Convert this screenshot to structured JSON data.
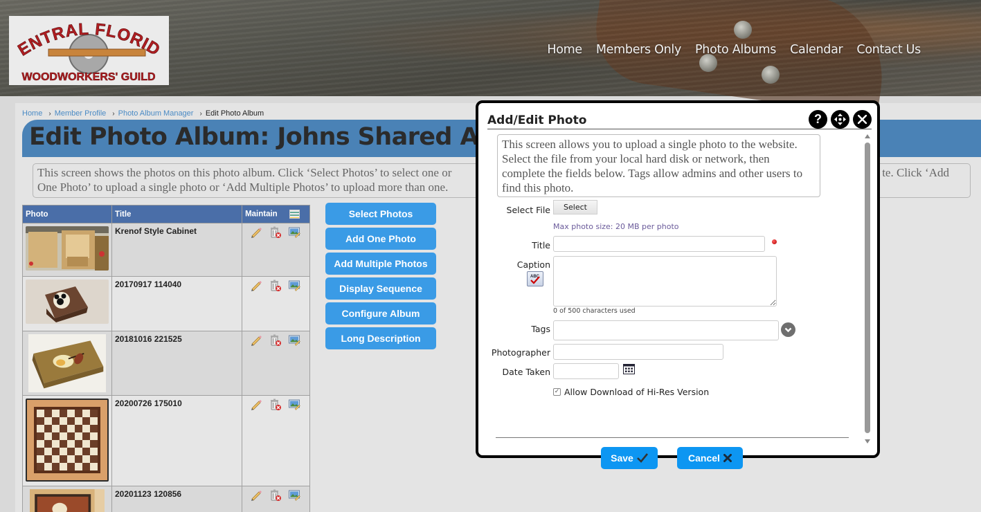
{
  "site": {
    "logo_line1": "CENTRAL FLORIDA",
    "logo_line2": "WOODWORKERS' GUILD",
    "nav": [
      "Home",
      "Members Only",
      "Photo Albums",
      "Calendar",
      "Contact Us"
    ]
  },
  "breadcrumb": [
    "Home",
    "Member Profile",
    "Photo Album Manager",
    "Edit Photo Album"
  ],
  "page_title": "Edit Photo Album: Johns Shared Album",
  "intro_text": "This screen shows the photos on this photo album. Click ‘Select Photos’ to select one or more photos to perform an action on. Click ‘Add One Photo’ to upload a single photo or ‘Add Multiple Photos’ to upload more than one. Click ‘Add One Photo’ to upload a single photo to the website.",
  "intro_text_visible_left": "This screen shows the photos on this photo album. Click ‘Select Photos’ to select one or",
  "intro_text_visible_left2": "One Photo’ to upload a single photo or ‘Add Multiple Photos’ to upload more than one.",
  "intro_text_visible_right": "te. Click ‘Add",
  "table": {
    "columns": [
      "Photo",
      "Title",
      "Maintain"
    ],
    "rows": [
      {
        "title": "Krenof Style Cabinet",
        "thumb": "cabinet"
      },
      {
        "title": "20170917 114040",
        "thumb": "mickey-box"
      },
      {
        "title": "20181016 221525",
        "thumb": "rose-box"
      },
      {
        "title": "20200726 175010",
        "thumb": "chessboard"
      },
      {
        "title": "20201123 120856",
        "thumb": "inlay-panel"
      }
    ]
  },
  "actions": [
    "Select Photos",
    "Add One Photo",
    "Add Multiple Photos",
    "Display Sequence",
    "Configure Album",
    "Long Description"
  ],
  "modal": {
    "title": "Add/Edit Photo",
    "description": "This screen allows you to upload a single photo to the website. Select the file from your local hard disk or network, then complete the fields below. Tags allow admins and other users to find this photo.",
    "select_file_label": "Select File",
    "select_button": "Select",
    "max_size_hint": "Max photo size: 20 MB per photo",
    "title_label": "Title",
    "title_value": "",
    "caption_label": "Caption",
    "caption_value": "",
    "char_count": "0 of 500 characters used",
    "tags_label": "Tags",
    "tags_value": "",
    "photographer_label": "Photographer",
    "photographer_value": "",
    "date_label": "Date Taken",
    "date_value": "",
    "allow_download_label": "Allow Download of Hi-Res Version",
    "allow_download_checked": true,
    "save_label": "Save",
    "cancel_label": "Cancel"
  },
  "colors": {
    "accent_blue": "#3a9be6",
    "title_bar": "#4a82b6",
    "table_header": "#4a6ea8",
    "modal_button": "#0d96f2"
  }
}
